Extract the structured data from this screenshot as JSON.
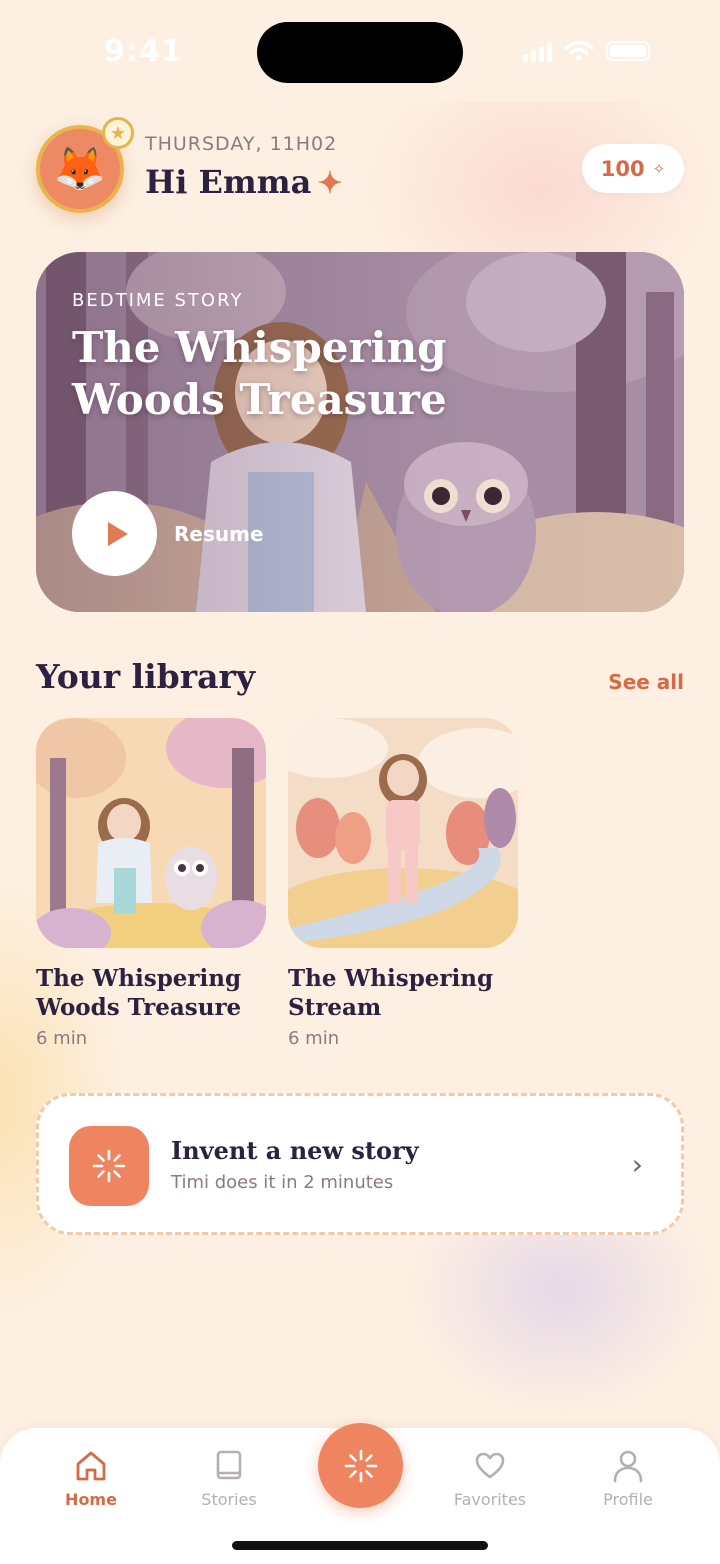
{
  "status_bar": {
    "time": "9:41"
  },
  "header": {
    "date": "THURSDAY, 11H02",
    "greeting": "Hi Emma",
    "avatar_emoji": "🦊",
    "points": "100"
  },
  "hero": {
    "kicker": "BEDTIME STORY",
    "title": "The Whispering Woods Treasure",
    "resume_label": "Resume"
  },
  "library": {
    "title": "Your library",
    "see_all": "See all",
    "items": [
      {
        "title": "The Whispering Woods Treasure",
        "duration": "6 min"
      },
      {
        "title": "The Whispering Stream",
        "duration": "6 min"
      }
    ]
  },
  "invent": {
    "title": "Invent a new story",
    "subtitle": "Timi does it in 2 minutes"
  },
  "tabs": [
    {
      "label": "Home",
      "icon": "home-icon",
      "active": true
    },
    {
      "label": "Stories",
      "icon": "book-icon",
      "active": false
    },
    {
      "label": "Favorites",
      "icon": "heart-icon",
      "active": false
    },
    {
      "label": "Profile",
      "icon": "user-icon",
      "active": false
    }
  ],
  "colors": {
    "accent": "#ef8560",
    "accent_text": "#d46b45",
    "heading": "#2c2140",
    "background": "#fdf0e2"
  }
}
